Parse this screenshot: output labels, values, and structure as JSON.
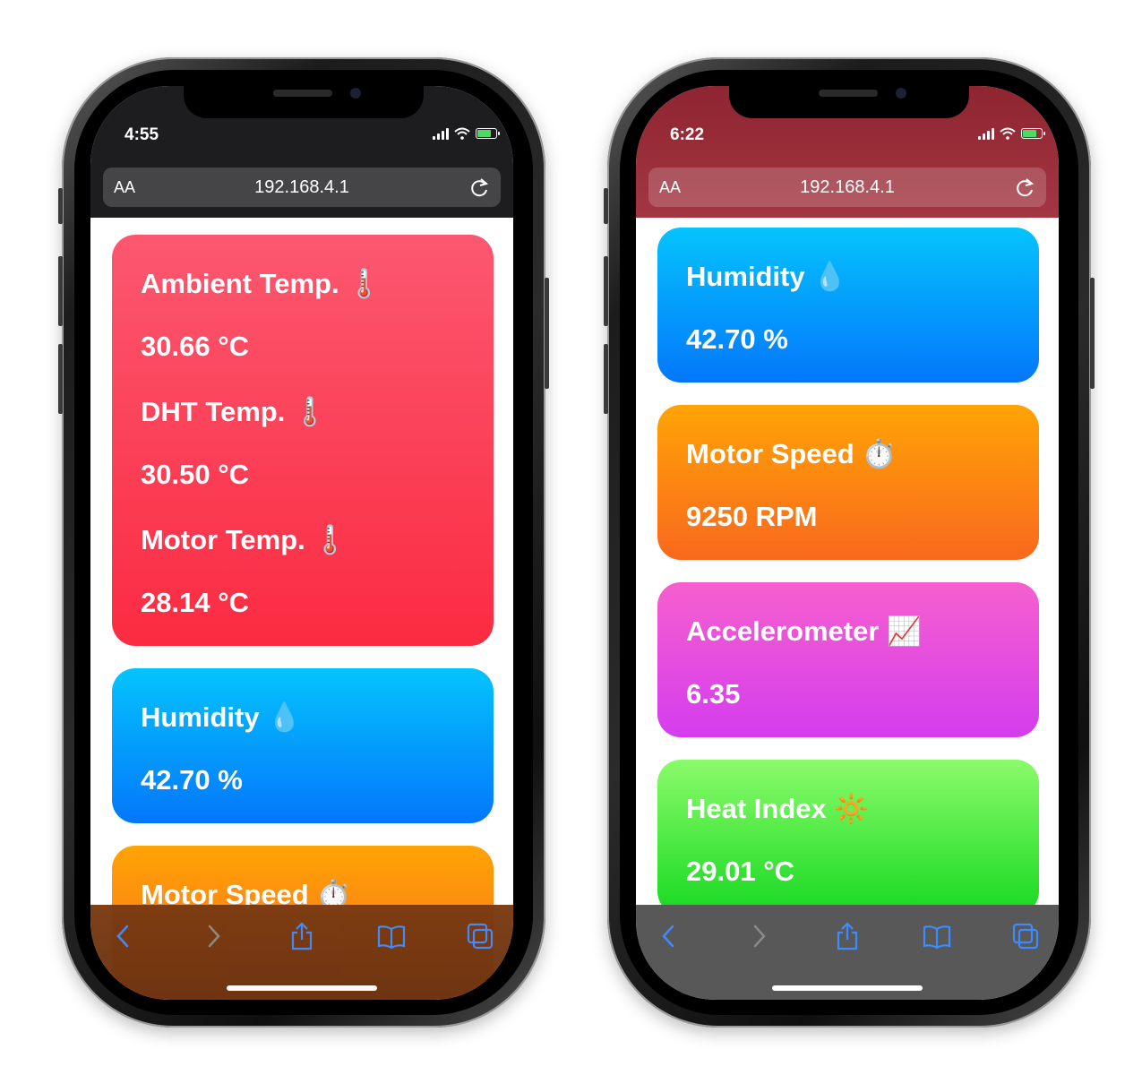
{
  "colors": {
    "temperature_card": "#fb3a52",
    "humidity_card": "#0593fc",
    "motor_speed_card": "#fd8812",
    "accelerometer_card": "#e54ede",
    "heat_index_card": "#4ce846",
    "toolbar_icon": "#3d8cff"
  },
  "phones": [
    {
      "status_bar": {
        "time": "4:55"
      },
      "browser": {
        "text_size_label": "AA",
        "url": "192.168.4.1"
      },
      "cards": {
        "ambient_label": "Ambient Temp. 🌡️",
        "ambient_value": "30.66 °C",
        "dht_label": "DHT Temp. 🌡️",
        "dht_value": "30.50 °C",
        "motor_temp_label": "Motor Temp. 🌡️",
        "motor_temp_value": "28.14 °C",
        "humidity_label": "Humidity 💧",
        "humidity_value": "42.70 %",
        "motor_speed_label": "Motor Speed ⏱️"
      },
      "toolbar": [
        "back-icon",
        "forward-icon",
        "share-icon",
        "bookmarks-icon",
        "tabs-icon"
      ]
    },
    {
      "status_bar": {
        "time": "6:22"
      },
      "browser": {
        "text_size_label": "AA",
        "url": "192.168.4.1"
      },
      "cards": {
        "humidity_label": "Humidity 💧",
        "humidity_value": "42.70 %",
        "motor_speed_label": "Motor Speed ⏱️",
        "motor_speed_value": "9250 RPM",
        "accelerometer_label": "Accelerometer 📈",
        "accelerometer_value": "6.35",
        "heat_index_label": "Heat Index 🔆",
        "heat_index_value": "29.01 °C"
      },
      "toolbar": [
        "back-icon",
        "forward-icon",
        "share-icon",
        "bookmarks-icon",
        "tabs-icon"
      ]
    }
  ]
}
